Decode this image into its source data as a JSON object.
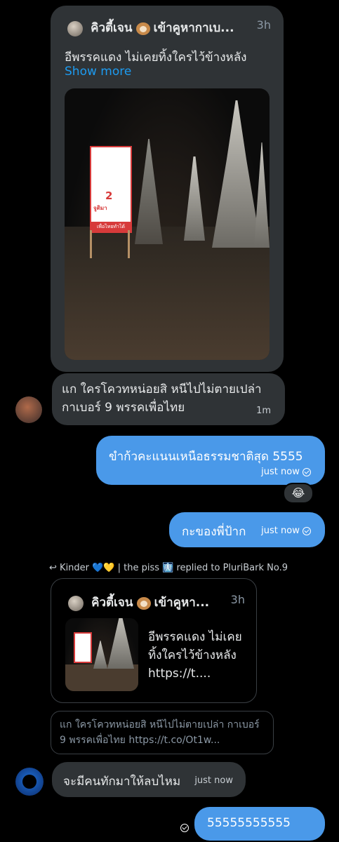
{
  "quoted_post": {
    "author": "คิวตี้เจน",
    "author_suffix": "เข้าคูหากาเบ...",
    "time": "3h",
    "text": "อีพรรคแดง ไม่เคยทิ้งใครไว้ข้างหลัง",
    "show_more": "Show more"
  },
  "messages": [
    {
      "text": "แก ใครโควทหน่อยสิ หนีไปไม่ตายเปล่า\nกาเบอร์ 9 พรรคเพื่อไทย",
      "time": "1m"
    },
    {
      "text": "ขำก้วคะแนนเหนือธรรมชาติสุด 5555",
      "time": "just now"
    },
    {
      "reaction": "😂"
    },
    {
      "text": "กะของพี่ป้าก",
      "time": "just now"
    },
    {
      "reply_header": "Kinder 💙💛 | the piss 🩻 replied to PluriBark No.9"
    },
    {
      "quoted_card": {
        "author": "คิวตี้เจน",
        "author_suffix": "เข้าคูหา...",
        "time": "3h",
        "text": "อีพรรคแดง ไม่เคยทิ้งใครไว้ข้างหลัง https://t...."
      }
    },
    {
      "quoted_reply": "แก ใครโควทหน่อยสิ หนีไปไม่ตายเปล่า กาเบอร์ 9 พรรคเพื่อไทย https://t.co/Ot1w..."
    },
    {
      "text": "จะมีคนทักมาให้ลบไหม",
      "time": "just now"
    },
    {
      "text": "55555555555"
    }
  ],
  "sign": {
    "number": "2",
    "name": "จูติมา",
    "slogan": "เพื่อไทยทำได้"
  }
}
